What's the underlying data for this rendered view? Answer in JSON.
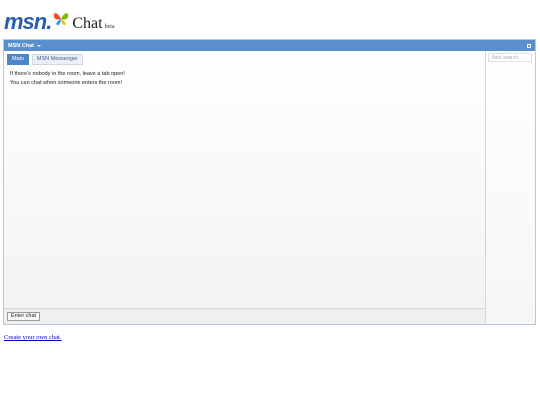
{
  "header": {
    "logo_text": "msn",
    "logo_suffix": ".",
    "chat_label": "Chat",
    "beta_label": "beta",
    "icons": {
      "logo": "butterfly-logo-icon"
    }
  },
  "window": {
    "title": "MSN Chat",
    "icons": {
      "dropdown": "caret-down-icon",
      "maximize": "maximize-icon"
    },
    "tabs": [
      {
        "label": "Main",
        "active": true
      },
      {
        "label": "MSN Messenger",
        "active": false
      }
    ],
    "messages": [
      "If there's nobody in the room, leave a tab open!",
      "You can chat when someone enters the room!"
    ],
    "sidebar": {
      "search_placeholder": "Nick search"
    },
    "footer": {
      "enter_chat_label": "Enter chat"
    }
  },
  "links": {
    "create_room_label": "Create your own chat."
  },
  "colors": {
    "titlebar": "#5b8fcc",
    "active_tab": "#4a86c5",
    "link": "#0000cc",
    "logo": "#2a5db0"
  }
}
